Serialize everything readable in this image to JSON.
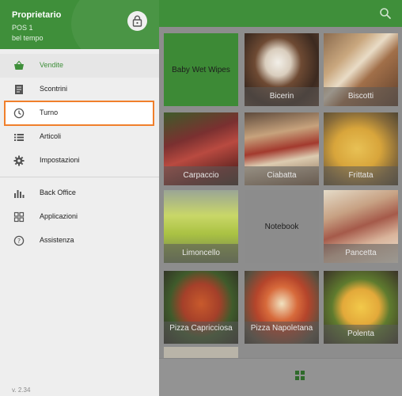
{
  "drawer": {
    "owner_name": "Proprietario",
    "pos_name": "POS 1",
    "store_name": "bel tempo",
    "lock_icon": "lock-icon",
    "items": [
      {
        "label": "Vendite",
        "icon": "basket-icon",
        "active": true
      },
      {
        "label": "Scontrini",
        "icon": "receipt-icon"
      },
      {
        "label": "Turno",
        "icon": "clock-icon",
        "highlighted": true
      },
      {
        "label": "Articoli",
        "icon": "list-icon"
      },
      {
        "label": "Impostazioni",
        "icon": "gear-icon"
      },
      {
        "label": "Back Office",
        "icon": "bar-chart-icon"
      },
      {
        "label": "Applicazioni",
        "icon": "apps-icon"
      },
      {
        "label": "Assistenza",
        "icon": "help-icon"
      }
    ],
    "version": "v. 2.34"
  },
  "appbar": {
    "search_icon": "search-icon"
  },
  "products": [
    {
      "name": "Baby Wet Wipes",
      "type": "color",
      "color": "#3d8a36"
    },
    {
      "name": "Bicerin",
      "type": "photo"
    },
    {
      "name": "Biscotti",
      "type": "photo"
    },
    {
      "name": "Carpaccio",
      "type": "photo"
    },
    {
      "name": "Ciabatta",
      "type": "photo"
    },
    {
      "name": "Frittata",
      "type": "photo"
    },
    {
      "name": "Limoncello",
      "type": "photo"
    },
    {
      "name": "Notebook",
      "type": "color",
      "color": "#8c8c8c"
    },
    {
      "name": "Pancetta",
      "type": "photo"
    },
    {
      "name": "Pizza Capricciosa",
      "type": "photo"
    },
    {
      "name": "Pizza Napoletana",
      "type": "photo"
    },
    {
      "name": "Polenta",
      "type": "photo"
    }
  ],
  "colors": {
    "brand_green": "#3f8f3a",
    "highlight_orange": "#f07f2b",
    "scrim_grey": "#8d8d8d"
  },
  "bottombar": {
    "toggle_icon": "grid-view-icon"
  }
}
